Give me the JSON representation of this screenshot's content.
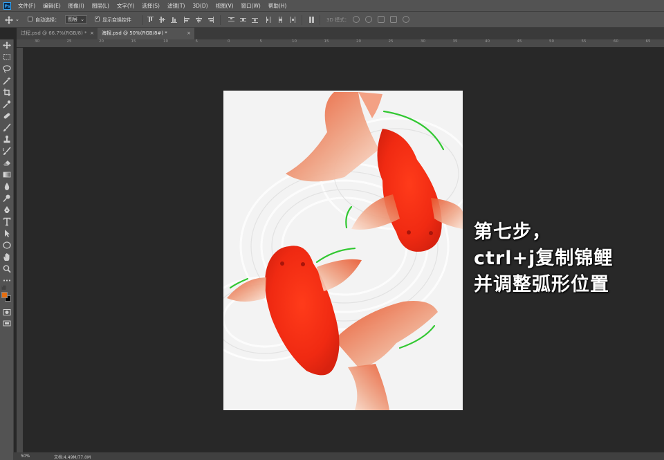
{
  "app": {
    "logo": "Ps"
  },
  "menu": [
    "文件(F)",
    "编辑(E)",
    "图像(I)",
    "图层(L)",
    "文字(Y)",
    "选择(S)",
    "滤镜(T)",
    "3D(D)",
    "视图(V)",
    "窗口(W)",
    "帮助(H)"
  ],
  "options": {
    "auto_select_label": "自动选择：",
    "auto_select_checked": false,
    "layer_dropdown_value": "图层",
    "show_transform_label": "显示变换控件",
    "show_transform_checked": true,
    "mode_3d_label": "3D 模式："
  },
  "tabs": [
    {
      "label": "过程.psd @ 66.7%(RGB/8) *",
      "active": false,
      "close": "×"
    },
    {
      "label": "海报.psd @ 50%(RGB/8#) *",
      "active": true,
      "close": "×"
    }
  ],
  "ruler_top_labels": [
    "30",
    "25",
    "20",
    "15",
    "10",
    "5",
    "0",
    "5",
    "10",
    "15",
    "20",
    "25",
    "30",
    "35",
    "40",
    "45",
    "50",
    "55",
    "60",
    "65"
  ],
  "colors": {
    "foreground": "#e46d10",
    "background": "#000000",
    "accent": "#31a8ff"
  },
  "tools": [
    "move-icon",
    "marquee-icon",
    "lasso-icon",
    "magic-wand-icon",
    "crop-icon",
    "eyedropper-icon",
    "healing-brush-icon",
    "brush-icon",
    "clone-stamp-icon",
    "history-brush-icon",
    "eraser-icon",
    "gradient-icon",
    "blur-icon",
    "dodge-icon",
    "pen-icon",
    "type-icon",
    "path-selection-icon",
    "ellipse-icon",
    "hand-icon",
    "zoom-icon",
    "more-icon"
  ],
  "caption": {
    "line1": "第七步，",
    "line2": "ctrl+j复制锦鲤",
    "line3": "并调整弧形位置"
  },
  "status": {
    "zoom": "50%",
    "doc_info": "文档:4.49M/77.0M"
  }
}
